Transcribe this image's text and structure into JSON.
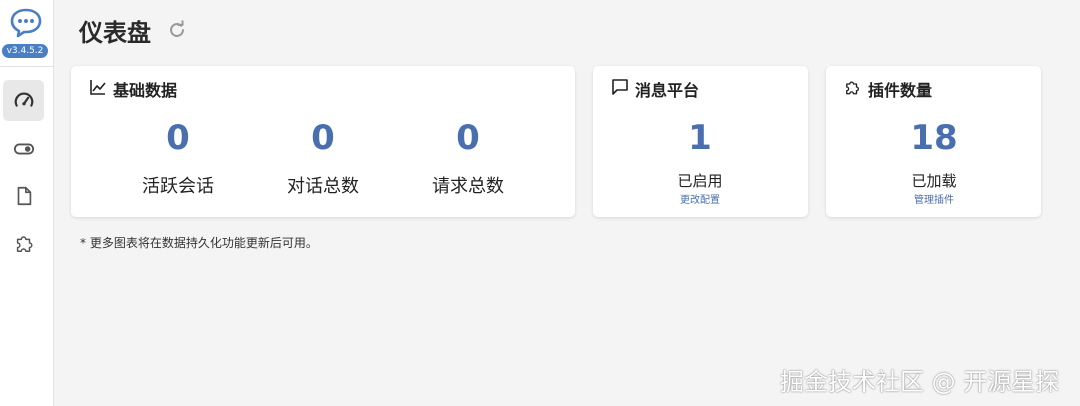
{
  "app": {
    "version": "v3.4.5.2"
  },
  "page": {
    "title": "仪表盘"
  },
  "sidebar": {
    "items": [
      {
        "name": "dashboard",
        "icon": "speedometer-icon",
        "active": true
      },
      {
        "name": "switch",
        "icon": "toggle-icon",
        "active": false
      },
      {
        "name": "documents",
        "icon": "file-icon",
        "active": false
      },
      {
        "name": "plugins",
        "icon": "puzzle-icon",
        "active": false
      }
    ]
  },
  "cards": {
    "basic": {
      "title": "基础数据",
      "icon": "chart-line-icon",
      "stats": [
        {
          "value": "0",
          "label": "活跃会话"
        },
        {
          "value": "0",
          "label": "对话总数"
        },
        {
          "value": "0",
          "label": "请求总数"
        }
      ]
    },
    "platform": {
      "title": "消息平台",
      "icon": "chat-bubble-icon",
      "value": "1",
      "label": "已启用",
      "link": "更改配置"
    },
    "plugins": {
      "title": "插件数量",
      "icon": "puzzle-icon",
      "value": "18",
      "label": "已加载",
      "link": "管理插件"
    }
  },
  "footnote": "* 更多图表将在数据持久化功能更新后可用。",
  "watermark": "掘金技术社区 @ 开源星探",
  "colors": {
    "accent": "#4a6fae",
    "badge": "#4a7fc6",
    "background": "#f4f4f4"
  }
}
